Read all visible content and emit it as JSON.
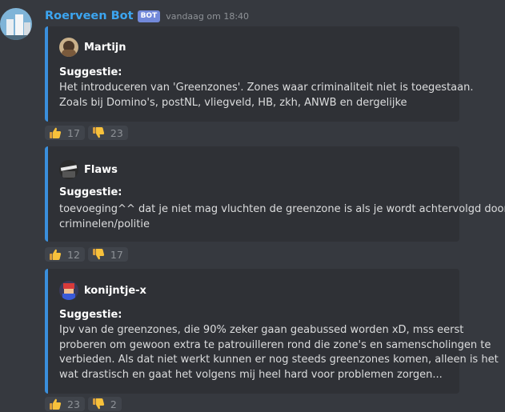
{
  "message": {
    "author": "Roerveen Bot",
    "badge": "BOT",
    "timestamp": "vandaag om 18:40"
  },
  "embeds": [
    {
      "author": "Martijn",
      "field_title": "Suggestie:",
      "lines": [
        "Het introduceren van 'Greenzones'. Zones waar criminaliteit niet is toegestaan.",
        "Zoals bij Domino's, postNL, vliegveld, HB, zkh, ANWB en dergelijke"
      ],
      "reactions": {
        "up": "17",
        "down": "23"
      }
    },
    {
      "author": "Flaws",
      "field_title": "Suggestie:",
      "lines": [
        "toevoeging^^ dat je niet mag vluchten de greenzone is als je wordt achtervolgd door",
        "criminelen/politie"
      ],
      "reactions": {
        "up": "12",
        "down": "17"
      }
    },
    {
      "author": "konijntje-x",
      "field_title": "Suggestie:",
      "lines": [
        "Ipv van de greenzones, die 90% zeker gaan geabussed worden xD, mss eerst",
        "proberen om gewoon extra te patrouilleren rond die zone's en samenscholingen te",
        "verbieden. Als dat niet werkt kunnen er nog steeds greenzones komen, alleen is het",
        "wat drastisch en gaat het volgens mij heel hard voor problemen zorgen..."
      ],
      "reactions": {
        "up": "23",
        "down": "2"
      }
    }
  ],
  "colors": {
    "background": "#36393f",
    "embed_bg": "#2f3136",
    "embed_border": "#3a8fdc",
    "bot_name": "#3ca5f0",
    "badge": "#7289da"
  },
  "icons": {
    "thumbs_up": "thumbs-up-icon",
    "thumbs_down": "thumbs-down-icon"
  }
}
